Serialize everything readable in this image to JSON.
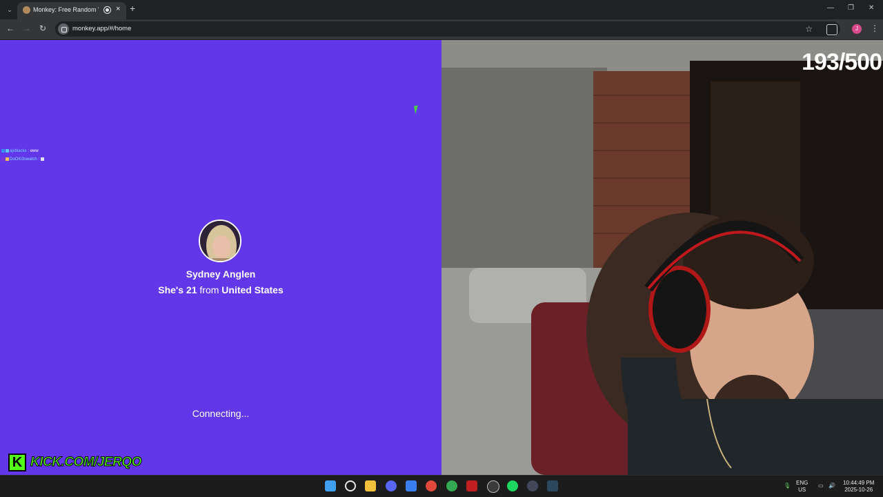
{
  "browser": {
    "tab_title": "Monkey: Free Random Vide",
    "new_tab_label": "+",
    "close_tab_label": "×",
    "url": "monkey.app/#/home",
    "profile_initial": "J"
  },
  "chat": [
    {
      "user": "ajxblackx",
      "message": " : eww"
    },
    {
      "user": "DoOKi3swatch",
      "message": " : "
    }
  ],
  "match": {
    "name": "Sydney Anglen",
    "info_prefix": "She's",
    "age": "21",
    "info_mid": "from",
    "country": "United States",
    "status": "Connecting..."
  },
  "stream": {
    "kick_logo_letter": "K",
    "kick_url": "KICK.COM/JERQO",
    "counter": "193/500"
  },
  "system_tray": {
    "lang_top": "ENG",
    "lang_bottom": "US",
    "time": "10:44:49 PM",
    "date": "2025-10-26"
  },
  "colors": {
    "monkey_purple": "#6237ea",
    "kick_green": "#53fc18"
  }
}
